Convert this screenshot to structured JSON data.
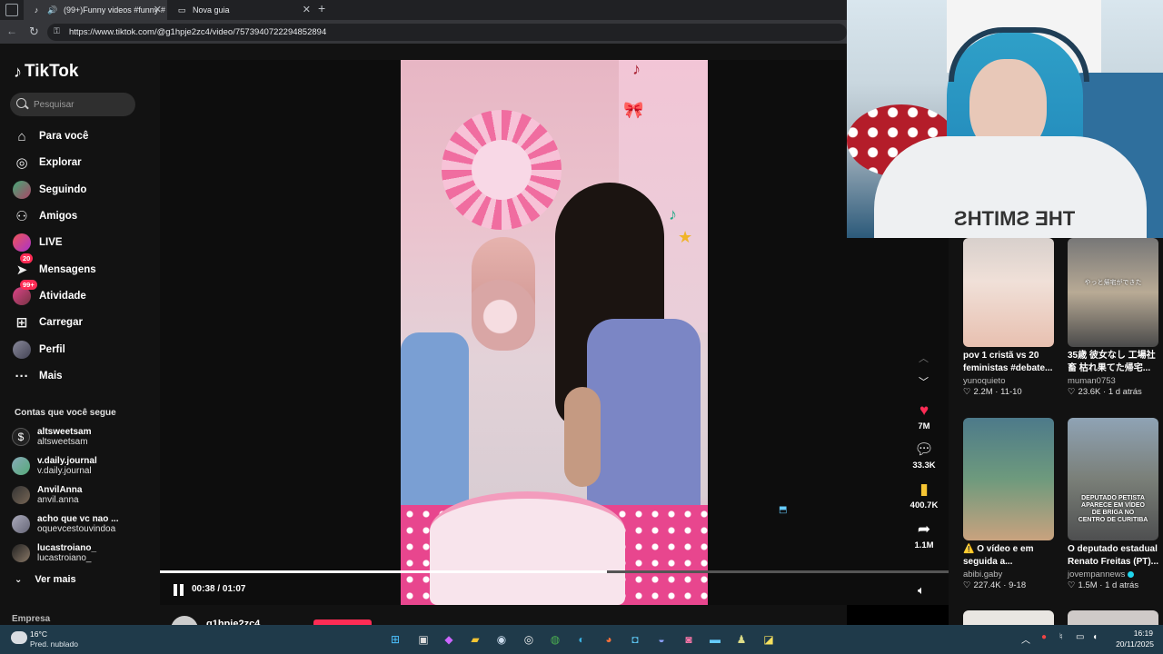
{
  "browser": {
    "tabs": [
      {
        "label": "(99+)Funny videos #funny #"
      },
      {
        "label": "Nova guia"
      }
    ],
    "new_tab": "+",
    "url": "https://www.tiktok.com/@g1hpje2zc4/video/7573940722294852894"
  },
  "tiktok": {
    "logo": "TikTok",
    "search_placeholder": "Pesquisar",
    "nav": [
      {
        "label": "Para você",
        "icon": "home-icon"
      },
      {
        "label": "Explorar",
        "icon": "compass-icon"
      },
      {
        "label": "Seguindo",
        "icon": "following-avatar-icon"
      },
      {
        "label": "Amigos",
        "icon": "friends-icon"
      },
      {
        "label": "LIVE",
        "icon": "live-icon"
      },
      {
        "label": "Mensagens",
        "icon": "messages-icon",
        "badge": "20"
      },
      {
        "label": "Atividade",
        "icon": "activity-icon",
        "badge": "99+"
      },
      {
        "label": "Carregar",
        "icon": "upload-icon"
      },
      {
        "label": "Perfil",
        "icon": "profile-icon"
      },
      {
        "label": "Mais",
        "icon": "more-icon"
      }
    ],
    "following_title": "Contas que você segue",
    "following": [
      {
        "name": "altsweetsam",
        "handle": "altsweetsam"
      },
      {
        "name": "v.daily.journal",
        "handle": "v.daily.journal"
      },
      {
        "name": "AnvilAnna",
        "handle": "anvil.anna"
      },
      {
        "name": "acho que vc nao ...",
        "handle": "oquevcestouvindoa"
      },
      {
        "name": "lucastroiano_",
        "handle": "lucastroiano_"
      }
    ],
    "ver_mais": "Ver mais",
    "empresa": "Empresa"
  },
  "player": {
    "time": "00:38 / 01:07",
    "progress": 0.567,
    "author": "g1hpje2zc4"
  },
  "actions": {
    "likes": "7M",
    "comments": "33.3K",
    "saves": "400.7K",
    "shares": "1.1M"
  },
  "webcam": {
    "shirt_text": "THE SMITHS"
  },
  "related": [
    {
      "title": "pov 1 cristã vs 20\nfeministas #debate...",
      "user": "yunoquieto",
      "likes": "2.2M",
      "date": "11-10",
      "verified": false,
      "overlay": ""
    },
    {
      "title": "35歳 彼女なし 工場社\n畜 枯れ果てた帰宅...",
      "user": "muman0753",
      "likes": "23.6K",
      "date": "1 d atrás",
      "verified": false,
      "overlay": "やっと帰宅ができた"
    },
    {
      "title": "⚠️ O vídeo e em\nseguida a...",
      "user": "abibi.gaby",
      "likes": "227.4K",
      "date": "9-18",
      "verified": false,
      "overlay": ""
    },
    {
      "title": "O deputado estadual\nRenato Freitas (PT)...",
      "user": "jovempannews",
      "likes": "1.5M",
      "date": "1 d atrás",
      "verified": true,
      "overlay": "DEPUTADO PETISTA\nAPARECE EM VÍDEO\nDE BRIGA NO\nCENTRO DE CURITIBA"
    }
  ],
  "taskbar": {
    "temp": "16°C",
    "weather": "Pred. nublado",
    "time": "16:19",
    "date": "20/11/2025"
  },
  "colors": {
    "accent": "#fe2c55",
    "background": "#121212",
    "taskbar": "#1f3a4a"
  }
}
